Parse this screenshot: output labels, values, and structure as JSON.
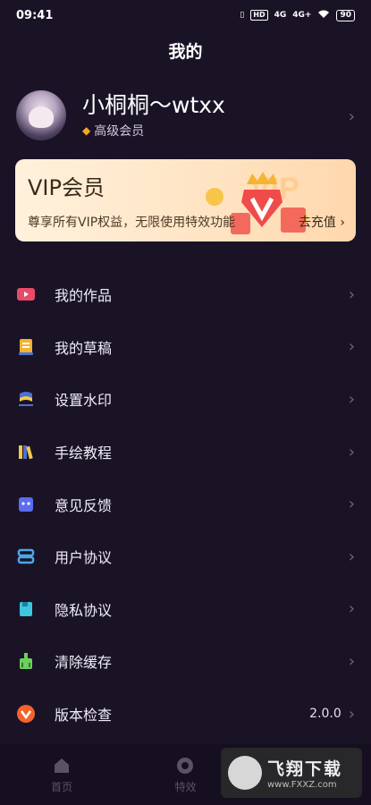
{
  "status": {
    "time": "09:41",
    "net1": "4G",
    "net2": "4G+",
    "hd": "HD",
    "battery": "90"
  },
  "header": {
    "title": "我的"
  },
  "profile": {
    "username": "小桐桐～wtxx",
    "member_label": "高级会员"
  },
  "vip": {
    "title": "VIP会员",
    "description": "尊享所有VIP权益，无限使用特效功能",
    "link": "去充值"
  },
  "menu": [
    {
      "label": "我的作品",
      "icon": "video-icon",
      "color": "#e84a6a"
    },
    {
      "label": "我的草稿",
      "icon": "draft-icon",
      "color": "#f5b12e"
    },
    {
      "label": "设置水印",
      "icon": "watermark-icon",
      "color": "#4b6fd6"
    },
    {
      "label": "手绘教程",
      "icon": "books-icon",
      "color": "#f2c94c"
    },
    {
      "label": "意见反馈",
      "icon": "feedback-icon",
      "color": "#5a6cf0"
    },
    {
      "label": "用户协议",
      "icon": "agreement-icon",
      "color": "#4aa9e8"
    },
    {
      "label": "隐私协议",
      "icon": "privacy-icon",
      "color": "#3ec6e0"
    },
    {
      "label": "清除缓存",
      "icon": "clear-cache-icon",
      "color": "#6ccf5e"
    },
    {
      "label": "版本检查",
      "icon": "version-icon",
      "color": "#f2642c",
      "value": "2.0.0"
    }
  ],
  "tabs": [
    {
      "label": "首页",
      "icon": "home-icon"
    },
    {
      "label": "特效",
      "icon": "effects-icon"
    },
    {
      "label": "",
      "icon": "profile-icon"
    }
  ],
  "watermark": {
    "main": "飞翔下载",
    "sub": "www.FXXZ.com"
  }
}
